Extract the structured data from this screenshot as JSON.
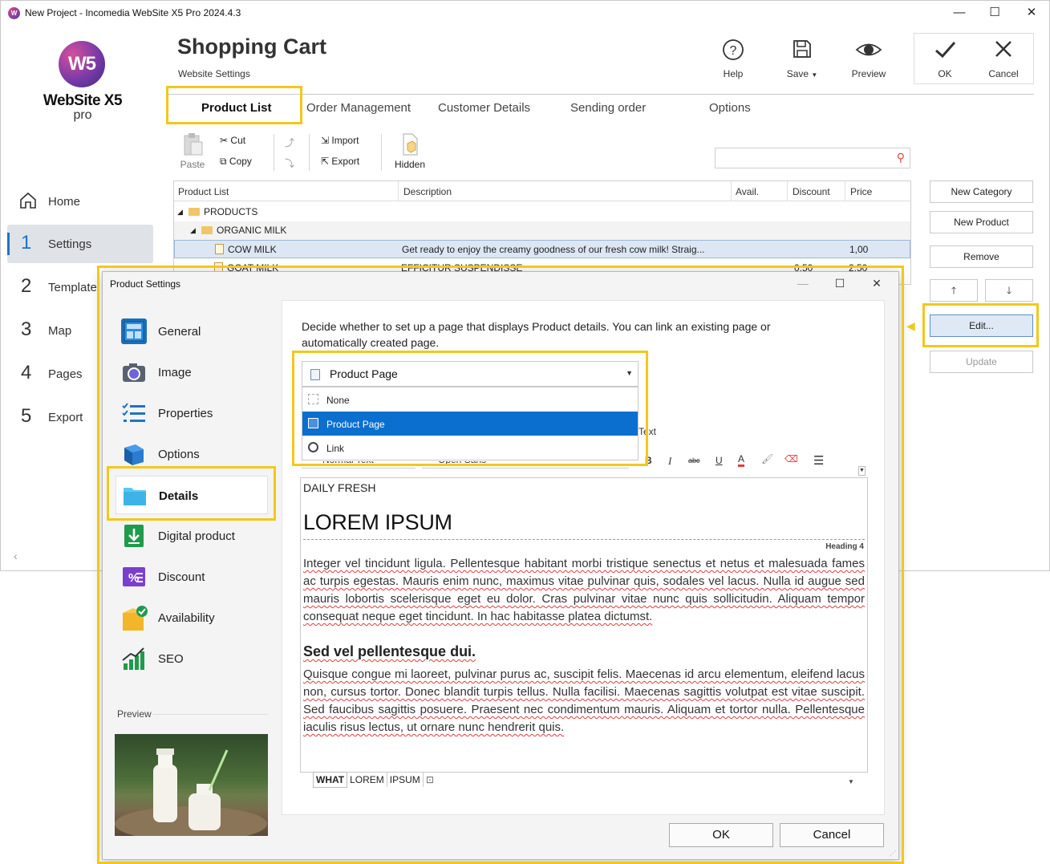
{
  "window": {
    "title": "New Project - Incomedia WebSite X5 Pro 2024.4.3",
    "minimize": "—",
    "maximize": "☐",
    "close": "✕"
  },
  "logo": {
    "mark": "W5",
    "name": "WebSite X5",
    "edition": "pro"
  },
  "sidebar": {
    "items": [
      {
        "num": "",
        "label": "Home"
      },
      {
        "num": "1",
        "label": "Settings"
      },
      {
        "num": "2",
        "label": "Template"
      },
      {
        "num": "3",
        "label": "Map"
      },
      {
        "num": "4",
        "label": "Pages"
      },
      {
        "num": "5",
        "label": "Export"
      }
    ],
    "collapse": "‹"
  },
  "header": {
    "title": "Shopping Cart",
    "subtitle": "Website Settings",
    "help": "Help",
    "save": "Save",
    "preview": "Preview",
    "ok": "OK",
    "cancel": "Cancel"
  },
  "tabs": [
    "Product List",
    "Order Management",
    "Customer Details",
    "Sending order",
    "Options"
  ],
  "ribbon": {
    "paste": "Paste",
    "cut": "Cut",
    "copy": "Copy",
    "import": "Import",
    "export": "Export",
    "hidden": "Hidden",
    "search_placeholder": ""
  },
  "grid": {
    "columns": [
      "Product List",
      "Description",
      "Avail.",
      "Discount",
      "Price"
    ],
    "rows": [
      {
        "name": "PRODUCTS",
        "description": "",
        "avail": "",
        "discount": "",
        "price": ""
      },
      {
        "name": "ORGANIC MILK",
        "description": "",
        "avail": "",
        "discount": "",
        "price": ""
      },
      {
        "name": "COW MILK",
        "description": "Get ready to enjoy the creamy goodness of our fresh cow milk! Straig...",
        "avail": "",
        "discount": "",
        "price": "1,00"
      },
      {
        "name": "GOAT MILK",
        "description": "EFFICITUR SUSPENDISSE",
        "avail": "",
        "discount": "0,50",
        "price": "2,50"
      }
    ]
  },
  "right_buttons": {
    "new_category": "New Category",
    "new_product": "New Product",
    "remove": "Remove",
    "up": "🡑",
    "down": "🡓",
    "edit": "Edit...",
    "update": "Update"
  },
  "dialog": {
    "title": "Product Settings",
    "categories": [
      "General",
      "Image",
      "Properties",
      "Options",
      "Details",
      "Digital product",
      "Discount",
      "Availability",
      "SEO"
    ],
    "preview_label": "Preview",
    "description": "Decide whether to set up a page that displays Product details. You can link an existing page or automatically created page.",
    "page_type": {
      "selected": "Product Page",
      "options": [
        "None",
        "Product Page",
        "Link"
      ]
    },
    "editor_toolbar": {
      "text_label": "Text",
      "style": "Normal Text",
      "font": "Open Sans"
    },
    "editor": {
      "kicker": "DAILY FRESH",
      "heading": "LOREM IPSUM",
      "heading_tag": "Heading 4",
      "para1": "Integer vel tincidunt ligula. Pellentesque habitant morbi tristique senectus et netus et malesuada fames ac turpis egestas. Mauris enim nunc, maximus vitae pulvinar quis, sodales vel lacus. Nulla id augue sed mauris lobortis scelerisque eget eu dolor. Cras pulvinar vitae nunc quis sollicitudin. Aliquam tempor consequat neque eget tincidunt. In hac habitasse platea dictumst.",
      "subheading": "Sed vel pellentesque dui.",
      "para2": "Quisque congue mi laoreet, pulvinar purus ac, suscipit felis. Maecenas id arcu elementum, eleifend lacus non, cursus tortor. Donec blandit turpis tellus. Nulla facilisi. Maecenas sagittis volutpat est vitae suscipit. Sed faucibus sagittis posuere. Praesent nec condimentum mauris. Aliquam et tortor nulla. Pellentesque iaculis risus lectus, ut ornare nunc hendrerit quis."
    },
    "breadcrumb": [
      "WHAT",
      "LOREM",
      "IPSUM"
    ],
    "ok": "OK",
    "cancel": "Cancel"
  },
  "colors": {
    "accent": "#1f73c4",
    "highlight": "#f2c81c",
    "selection": "#0a6fcf"
  }
}
